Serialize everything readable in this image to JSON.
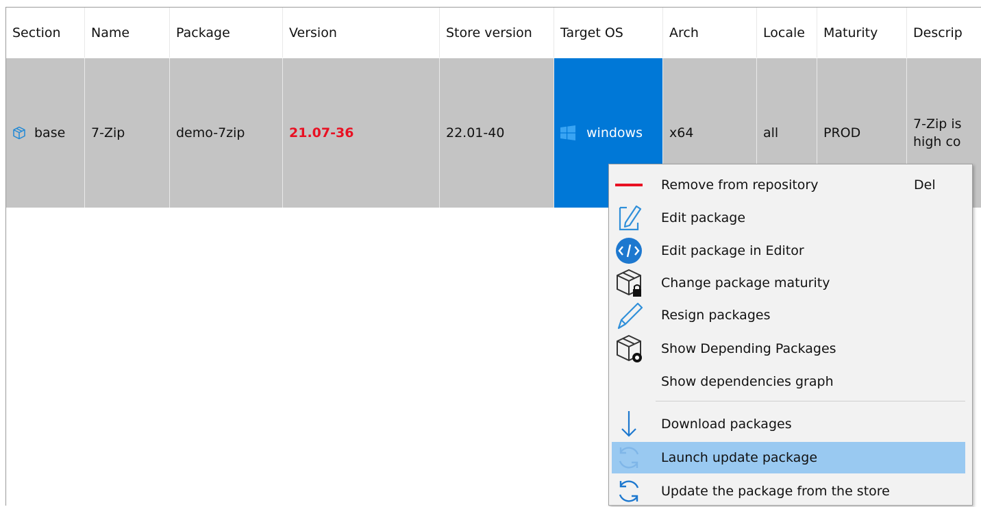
{
  "columns": {
    "section": "Section",
    "name": "Name",
    "package": "Package",
    "version": "Version",
    "store_version": "Store version",
    "target_os": "Target OS",
    "arch": "Arch",
    "locale": "Locale",
    "maturity": "Maturity",
    "description": "Descrip"
  },
  "row": {
    "section": "base",
    "name": "7-Zip",
    "package": "demo-7zip",
    "version": "21.07-36",
    "store_version": "22.01-40",
    "target_os": "windows",
    "arch": "x64",
    "locale": "all",
    "maturity": "PROD",
    "description_line1": "7-Zip is",
    "description_line2": "high co"
  },
  "colors": {
    "selection": "#0078d7",
    "row_bg": "#c4c4c4",
    "version_outdated": "#e81123",
    "menu_highlight": "#99c9f1"
  },
  "context_menu": {
    "items": [
      {
        "label": "Remove from repository",
        "shortcut": "Del",
        "icon": "remove-icon"
      },
      {
        "label": "Edit package",
        "icon": "edit-icon"
      },
      {
        "label": "Edit package in Editor",
        "icon": "code-editor-icon"
      },
      {
        "label": "Change package maturity",
        "icon": "package-lock-icon"
      },
      {
        "label": "Resign packages",
        "icon": "pencil-icon"
      },
      {
        "label": "Show Depending Packages",
        "icon": "package-eye-icon"
      },
      {
        "label": "Show dependencies graph",
        "icon": ""
      },
      {
        "label": "Download packages",
        "icon": "download-arrow-icon"
      },
      {
        "label": "Launch update package",
        "icon": "refresh-icon",
        "highlighted": true
      },
      {
        "label": "Update the package from the store",
        "icon": "refresh-icon"
      }
    ]
  }
}
